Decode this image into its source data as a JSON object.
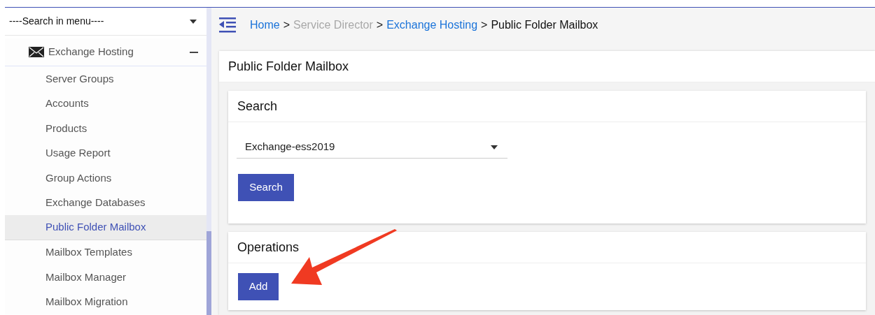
{
  "sidebar": {
    "search": {
      "value": "----Search in menu----"
    },
    "group": {
      "label": "Exchange Hosting",
      "expanded": true,
      "items": [
        {
          "label": "Server Groups",
          "selected": false
        },
        {
          "label": "Accounts",
          "selected": false
        },
        {
          "label": "Products",
          "selected": false
        },
        {
          "label": "Usage Report",
          "selected": false
        },
        {
          "label": "Group Actions",
          "selected": false
        },
        {
          "label": "Exchange Databases",
          "selected": false
        },
        {
          "label": "Public Folder Mailbox",
          "selected": true
        },
        {
          "label": "Mailbox Templates",
          "selected": false
        },
        {
          "label": "Mailbox Manager",
          "selected": false
        },
        {
          "label": "Mailbox Migration",
          "selected": false
        }
      ]
    }
  },
  "breadcrumb": [
    {
      "label": "Home",
      "kind": "link"
    },
    {
      "separator": ">",
      "label": "Service Director",
      "kind": "muted"
    },
    {
      "separator": ">",
      "label": "Exchange Hosting",
      "kind": "link"
    },
    {
      "separator": ">",
      "label": "Public Folder Mailbox",
      "kind": "current"
    }
  ],
  "page": {
    "title": "Public Folder Mailbox",
    "search_card": {
      "title": "Search",
      "select": {
        "value": "Exchange-ess2019"
      },
      "button": "Search"
    },
    "operations_card": {
      "title": "Operations",
      "button": "Add"
    }
  }
}
